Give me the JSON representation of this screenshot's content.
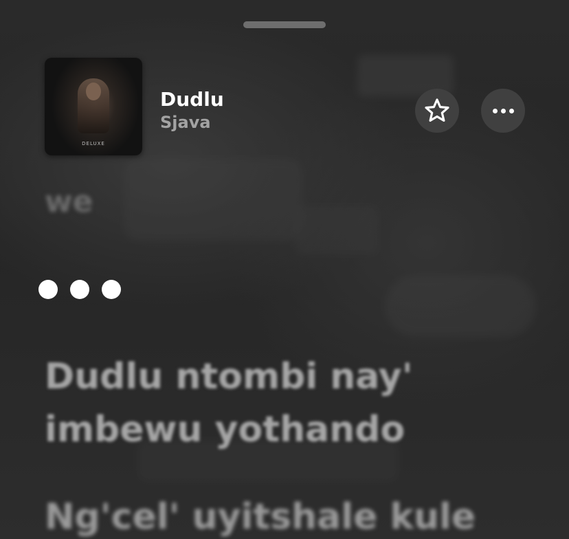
{
  "sheet": {
    "title": "Dudlu",
    "artist": "Sjava",
    "artwork_label": "DELUXE"
  },
  "actions": {
    "favorite_icon": "star-outline-icon",
    "more_icon": "ellipsis-icon"
  },
  "lyrics": {
    "previous_line": "we",
    "interlude_icon": "three-dots-interlude",
    "upcoming": [
      "Dudlu ntombi nay'",
      "imbewu yothando",
      "Ng'cel' uyitshale kule"
    ]
  },
  "colors": {
    "background": "#262626",
    "button_fill": "#404040",
    "title": "#ffffff",
    "artist": "#a3a3a3",
    "lyric_upcoming": "#a6a6a6"
  }
}
